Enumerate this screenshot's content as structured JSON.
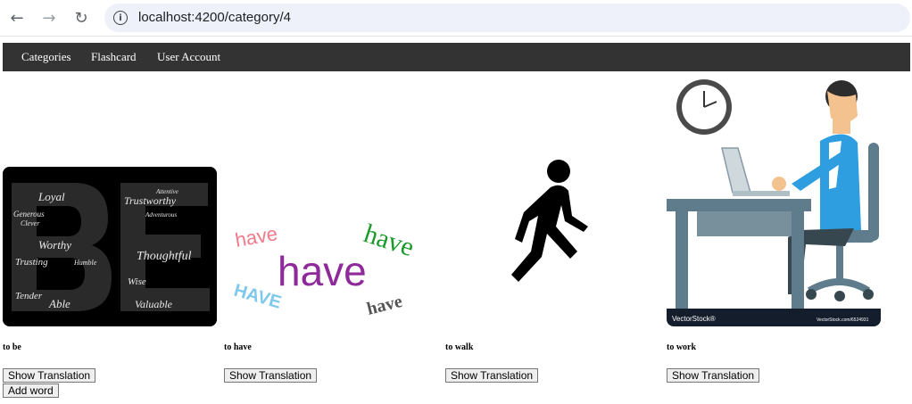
{
  "browser": {
    "url": "localhost:4200/category/4"
  },
  "navbar": {
    "items": [
      "Categories",
      "Flashcard",
      "User Account"
    ]
  },
  "cards": [
    {
      "word": "to be",
      "button": "Show Translation",
      "image_text": [
        "Loyal",
        "Trustworthy",
        "Generous",
        "Clever",
        "Thoughtful",
        "Worthy",
        "Tender",
        "Able",
        "Valuable",
        "Wise",
        "Humble",
        "Trusting",
        "Attentive",
        "Adventurous"
      ]
    },
    {
      "word": "to have",
      "button": "Show Translation",
      "image_text": [
        "have",
        "have",
        "have",
        "HAVE",
        "have"
      ]
    },
    {
      "word": "to walk",
      "button": "Show Translation"
    },
    {
      "word": "to work",
      "button": "Show Translation",
      "image_text": [
        "VectorStock®",
        "VectorStock.com/6524931"
      ]
    }
  ],
  "add_word": "Add word"
}
